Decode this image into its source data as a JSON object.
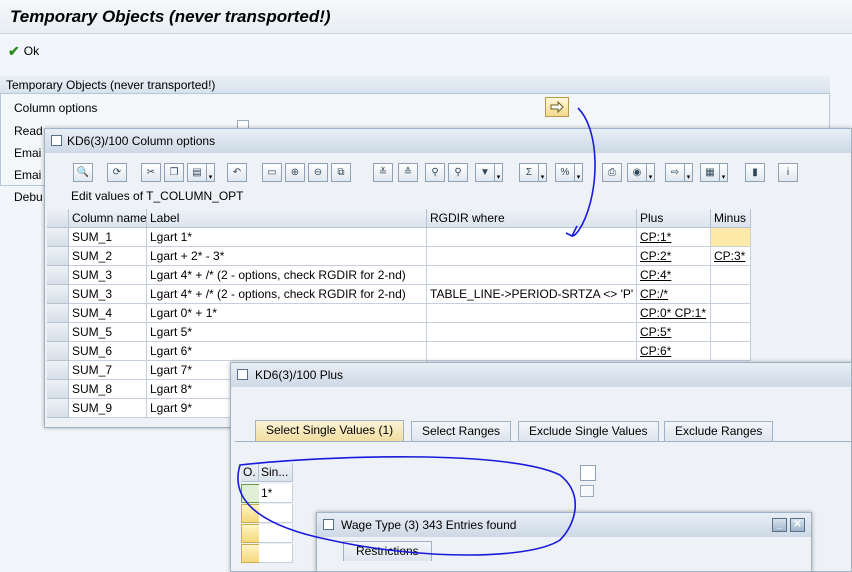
{
  "header": {
    "title": "Temporary Objects (never transported!)",
    "ok_label": "Ok"
  },
  "group": {
    "title": "Temporary Objects (never transported!)",
    "fields": [
      "Column options",
      "Read",
      "Emai",
      "Emai",
      "Debu"
    ]
  },
  "column_window": {
    "title": "KD6(3)/100 Column options",
    "edit_title": "Edit values of T_COLUMN_OPT",
    "columns": [
      "Column name",
      "Label",
      "RGDIR where",
      "Plus",
      "Minus"
    ],
    "rows": [
      {
        "name": "SUM_1",
        "label": "Lgart 1*",
        "rgdir": "",
        "plus": "CP:1*",
        "minus": ""
      },
      {
        "name": "SUM_2",
        "label": "Lgart + 2* - 3*",
        "rgdir": "",
        "plus": "CP:2*",
        "minus": "CP:3*"
      },
      {
        "name": "SUM_3",
        "label": "Lgart 4* + /* (2 - options, check RGDIR for 2-nd)",
        "rgdir": "",
        "plus": "CP:4*",
        "minus": ""
      },
      {
        "name": "SUM_3",
        "label": "Lgart 4* + /* (2 - options, check RGDIR for 2-nd)",
        "rgdir": "TABLE_LINE->PERIOD-SRTZA <> 'P'",
        "plus": "CP:/*",
        "minus": ""
      },
      {
        "name": "SUM_4",
        "label": "Lgart 0* + 1*",
        "rgdir": "",
        "plus": "CP:0* CP:1*",
        "minus": ""
      },
      {
        "name": "SUM_5",
        "label": "Lgart 5*",
        "rgdir": "",
        "plus": "CP:5*",
        "minus": ""
      },
      {
        "name": "SUM_6",
        "label": "Lgart 6*",
        "rgdir": "",
        "plus": "CP:6*",
        "minus": ""
      },
      {
        "name": "SUM_7",
        "label": "Lgart 7*",
        "rgdir": "",
        "plus": "",
        "minus": ""
      },
      {
        "name": "SUM_8",
        "label": "Lgart 8*",
        "rgdir": "",
        "plus": "",
        "minus": ""
      },
      {
        "name": "SUM_9",
        "label": "Lgart 9*",
        "rgdir": "",
        "plus": "",
        "minus": ""
      }
    ]
  },
  "plus_window": {
    "title": "KD6(3)/100 Plus",
    "tabs": [
      "Select Single Values (1)",
      "Select Ranges",
      "Exclude Single Values",
      "Exclude Ranges"
    ],
    "col_o": "O.",
    "col_sin": "Sin...",
    "values": [
      "1*",
      "",
      "",
      "",
      ""
    ]
  },
  "wage_window": {
    "title": "Wage Type (3)  343 Entries found",
    "tab": "Restrictions"
  },
  "colors": {
    "accent": "#2e8b1d",
    "annotation": "#1a1adc"
  }
}
